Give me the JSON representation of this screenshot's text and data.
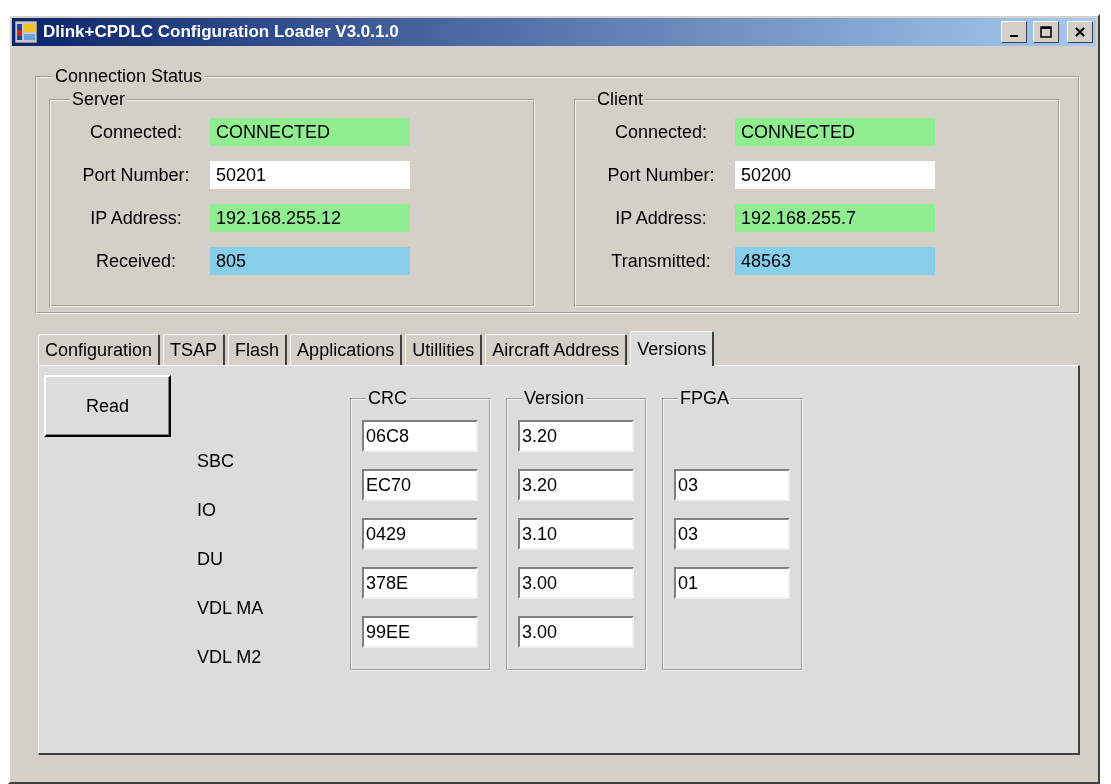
{
  "window": {
    "title": "Dlink+CPDLC Configuration Loader V3.0.1.0"
  },
  "connection_status": {
    "title": "Connection Status",
    "groups": [
      {
        "title": "Server",
        "fields": [
          {
            "label": "Connected:",
            "value": "CONNECTED",
            "kind": "status"
          },
          {
            "label": "Port Number:",
            "value": "50201",
            "kind": "input"
          },
          {
            "label": "IP Address:",
            "value": "192.168.255.12",
            "kind": "status"
          },
          {
            "label": "Received:",
            "value": "805",
            "kind": "counter"
          }
        ]
      },
      {
        "title": "Client",
        "fields": [
          {
            "label": "Connected:",
            "value": "CONNECTED",
            "kind": "status"
          },
          {
            "label": "Port Number:",
            "value": "50200",
            "kind": "input"
          },
          {
            "label": "IP Address:",
            "value": "192.168.255.7",
            "kind": "status"
          },
          {
            "label": "Transmitted:",
            "value": "48563",
            "kind": "counter"
          }
        ]
      }
    ]
  },
  "tabs": [
    {
      "label": "Configuration",
      "selected": false
    },
    {
      "label": "TSAP",
      "selected": false
    },
    {
      "label": "Flash",
      "selected": false
    },
    {
      "label": "Applications",
      "selected": false
    },
    {
      "label": "Utillities",
      "selected": false
    },
    {
      "label": "Aircraft Address",
      "selected": false
    },
    {
      "label": "Versions",
      "selected": true
    }
  ],
  "versions": {
    "read_button": "Read",
    "columns": [
      "CRC",
      "Version",
      "FPGA"
    ],
    "rows": [
      {
        "label": "SBC",
        "values": [
          "06C8",
          "3.20"
        ]
      },
      {
        "label": "IO",
        "values": [
          "EC70",
          "3.20",
          "03"
        ]
      },
      {
        "label": "DU",
        "values": [
          "0429",
          "3.10",
          "03"
        ]
      },
      {
        "label": "VDL MA",
        "values": [
          "378E",
          "3.00",
          "01"
        ]
      },
      {
        "label": "VDL M2",
        "values": [
          "99EE",
          "3.00"
        ]
      }
    ]
  }
}
